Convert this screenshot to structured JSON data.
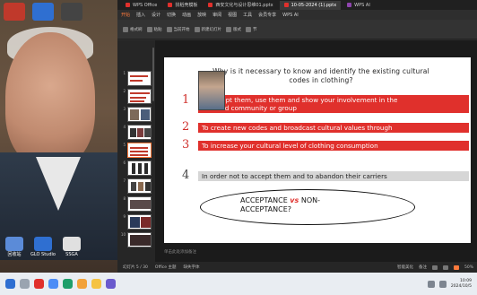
{
  "window": {
    "tabs": [
      {
        "label": "WPS Office",
        "color": "#e0302c"
      },
      {
        "label": "找稻壳模板",
        "color": "#e0302c"
      },
      {
        "label": "西安文化与设计思维01.pptx",
        "color": "#e0302c"
      },
      {
        "label": "10-05-2024 (1).pptx",
        "color": "#e0302c"
      },
      {
        "label": "WPS AI",
        "color": "#8e44ad"
      }
    ]
  },
  "menubar": {
    "items": [
      "开始",
      "插入",
      "设计",
      "切换",
      "动画",
      "放映",
      "审阅",
      "视图",
      "工具",
      "会员专享",
      "WPS AI"
    ],
    "active_index": 0
  },
  "ribbon": {
    "items": [
      "格式刷",
      "粘贴",
      "当前开始",
      "新建幻灯片",
      "版式",
      "节"
    ]
  },
  "slide": {
    "title_line1": "Why is it necessary to know and identify the existing cultural",
    "title_line2": "codes in clothing?",
    "points": [
      {
        "number": "1",
        "line1": "To accept them, use them and show your involvement in the",
        "line2": "selected community or group"
      },
      {
        "number": "2",
        "line": "To create new codes and broadcast cultural values through"
      },
      {
        "number": "3",
        "line": "To increase your cultural level of clothing consumption"
      },
      {
        "number": "4",
        "line": "In order not to accept them and to abandon their carriers"
      }
    ],
    "ellipse": {
      "left": "ACCEPTANCE",
      "vs": "vs",
      "right_line1": "NON-",
      "right_line2": "ACCEPTANCE?"
    }
  },
  "thumbnails": {
    "numbers": [
      "1",
      "2",
      "3",
      "4",
      "5",
      "6",
      "7",
      "8",
      "9",
      "10",
      "11",
      "12"
    ],
    "selected_index": 4
  },
  "notes": {
    "placeholder": "单击此处添加备注"
  },
  "statusbar": {
    "slide_info": "幻灯片 5 / 30",
    "theme": "Office 主题",
    "font_missing": "缺失字体",
    "smart_beautify": "智能美化",
    "notes": "备注",
    "zoom": "50%"
  },
  "desktop": {
    "icons": [
      {
        "label": "回收站",
        "color": "#5b8bd8"
      },
      {
        "label": "GLO Studio",
        "color": "#2f6fd1"
      },
      {
        "label": "SSGA",
        "color": "#e0e0e0"
      }
    ]
  },
  "taskbar": {
    "time": "10:09",
    "date": "2024/10/5"
  }
}
